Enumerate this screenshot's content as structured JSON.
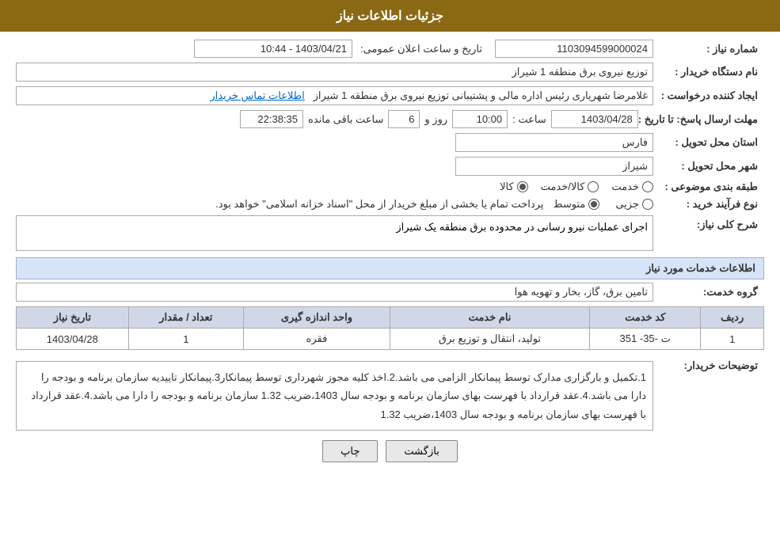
{
  "header": {
    "title": "جزئیات اطلاعات نیاز"
  },
  "fields": {
    "need_number_label": "شماره نیاز :",
    "need_number_value": "1103094599000024",
    "buyer_name_label": "نام دستگاه خریدار :",
    "buyer_name_value": "توزیع نیروی برق منطقه 1 شیراز",
    "creator_label": "ایجاد کننده درخواست :",
    "creator_value": "غلامرضا شهریاری رئیس اداره مالی و پشتیبانی  توزیع نیروی برق منطقه 1 شیراز",
    "contact_link": "اطلاعات تماس خریدار",
    "deadline_label": "مهلت ارسال پاسخ: تا تاریخ :",
    "date_value": "1403/04/28",
    "time_label": "ساعت :",
    "time_value": "10:00",
    "days_label": "روز و",
    "days_value": "6",
    "remaining_label": "ساعت باقی مانده",
    "remaining_value": "22:38:35",
    "announce_label": "تاریخ و ساعت اعلان عمومی:",
    "announce_value": "1403/04/21 - 10:44",
    "province_label": "استان محل تحویل :",
    "province_value": "فارس",
    "city_label": "شهر محل تحویل :",
    "city_value": "شیراز",
    "category_label": "طبقه بندی موضوعی :",
    "radio_options": [
      {
        "id": "khadamat",
        "label": "خدمت",
        "selected": false
      },
      {
        "id": "kala_khadamat",
        "label": "کالا/خدمت",
        "selected": false
      },
      {
        "id": "kala",
        "label": "کالا",
        "selected": true
      }
    ],
    "process_label": "نوع فرآیند خرید :",
    "process_options": [
      {
        "id": "jozi",
        "label": "جزیی",
        "selected": false
      },
      {
        "id": "motoset",
        "label": "متوسط",
        "selected": true
      }
    ],
    "process_description": "پرداخت تمام یا بخشی از مبلغ خریدار از محل \"اسناد خزانه اسلامی\" خواهد بود.",
    "need_description_label": "شرح کلی نیاز:",
    "need_description_value": "اجرای عملیات نیرو رسانی در محدوده برق منطقه یک شیراز",
    "service_info_header": "اطلاعات خدمات مورد نیاز",
    "service_group_label": "گروه خدمت:",
    "service_group_value": "تامین برق، گاز، بخار و تهویه هوا",
    "table": {
      "headers": [
        "ردیف",
        "کد خدمت",
        "نام خدمت",
        "واحد اندازه گیری",
        "تعداد / مقدار",
        "تاریخ نیاز"
      ],
      "rows": [
        {
          "row_num": "1",
          "service_code": "ت -35- 351",
          "service_name": "تولید، انتقال و توزیع برق",
          "unit": "فقره",
          "quantity": "1",
          "date": "1403/04/28"
        }
      ]
    },
    "buyer_notes_label": "توضیحات خریدار:",
    "buyer_notes_value": "1.تکمیل و بارگزاری مدارک توسط پیمانکار الزامی می باشد.2.اخذ کلیه مجوز شهرداری توسط پیمانکار3.پیمانکار تاییدیه سازمان برنامه و بودجه را دارا می باشد.4.عقد قرارداد با فهرست بهای سازمان برنامه و بودجه سال 1403،ضریب 1.32 سازمان برنامه و بودجه را دارا می باشد.4.عقد قرارداد با فهرست بهای سازمان برنامه و بودجه سال 1403،ضریب 1.32",
    "buttons": {
      "print_label": "چاپ",
      "back_label": "بازگشت"
    }
  }
}
